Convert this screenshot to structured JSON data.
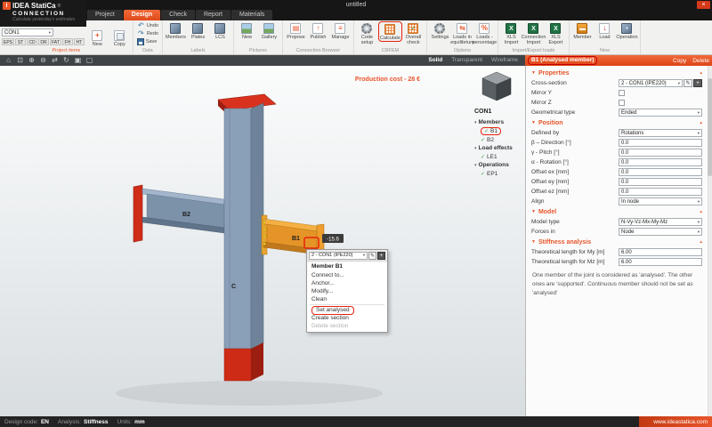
{
  "titlebar": {
    "title": "untitled"
  },
  "brand": {
    "name": "IDEA StatiCa",
    "reg": "®",
    "mark": "i",
    "product": "CONNECTION",
    "tagline": "Calculate yesterday's estimates"
  },
  "tabs": {
    "project": "Project",
    "design": "Design",
    "check": "Check",
    "report": "Report",
    "materials": "Materials"
  },
  "icons": {
    "close": "×",
    "add": "+",
    "edit": "✎",
    "check": "✓",
    "dropdown_arrow": "▾",
    "section_arrow": "▼",
    "collapse_up": "▴",
    "undo": "↶",
    "redo": "↷",
    "home": "⌂",
    "fit": "⊡",
    "zoom_in": "⊕",
    "zoom_out": "⊖",
    "pan": "⇄",
    "orbit": "↻",
    "select": "▣",
    "camera": "▢",
    "propose": "▤",
    "publish": "↑",
    "manage": "≡",
    "equilibrium": "⇆",
    "percent": "%",
    "xls": "X",
    "load_arrow": "↓",
    "member_beam": "▬"
  },
  "ribbon": {
    "project_selector": "CON1",
    "types": {
      "t0": "EPS",
      "t1": "ST",
      "t2": "CD",
      "t3": "DR",
      "t4": "FAT",
      "t5": "FH",
      "t6": "HT"
    },
    "project_items": {
      "name": "Project items",
      "new": "New",
      "copy": "Copy"
    },
    "data": {
      "name": "Data",
      "undo": "Undo",
      "redo": "Redo",
      "save": "Save"
    },
    "labels": {
      "name": "Labels",
      "members": "Members",
      "plates": "Plates",
      "lcs": "LCS"
    },
    "pictures": {
      "name": "Pictures",
      "new": "New",
      "gallery": "Gallery"
    },
    "browser": {
      "name": "Connection Browser",
      "propose": "Propose",
      "publish": "Publish",
      "manage": "Manage"
    },
    "cbfem": {
      "name": "CBFEM",
      "code_setup": "Code setup",
      "calculate": "Calculate",
      "overall_check": "Overall check"
    },
    "options": {
      "name": "Options",
      "settings": "Settings",
      "loads_eq": "Loads in equilibrium",
      "loads_pct": "Loads - percentage"
    },
    "impexp": {
      "name": "Import/Export loads",
      "xls_import": "XLS Import",
      "conn_import": "Connection Import",
      "xls_export": "XLS Export"
    },
    "new_group": {
      "name": "New",
      "member": "Member",
      "load": "Load",
      "operation": "Operation"
    }
  },
  "viewport": {
    "modes": {
      "solid": "Solid",
      "transparent": "Transparent",
      "wireframe": "Wireframe"
    },
    "production_cost": "Production cost - 28 €",
    "dim_label": "-15.6",
    "label_b1": "B1",
    "label_b2": "B2",
    "label_c": "C"
  },
  "tree": {
    "root": "CON1",
    "members": "Members",
    "b1": "B1",
    "b2": "B2",
    "load_effects": "Load effects",
    "le1": "LE1",
    "operations": "Operations",
    "ep1": "EP1"
  },
  "context_menu": {
    "header": "2 - CON1 (IPE220)",
    "title": "Member B1",
    "connect": "Connect to...",
    "anchor": "Anchor...",
    "modify": "Modify...",
    "clean": "Clean",
    "set_analysed": "Set analysed",
    "create_section": "Create section",
    "delete_section": "Delete section"
  },
  "panel": {
    "header": "B1 (Analysed member)",
    "copy": "Copy",
    "delete": "Delete",
    "sec_properties": "Properties",
    "cross_section_label": "Cross-section",
    "cross_section_value": "2 - CON1 (IPE220)",
    "mirror_y": "Mirror Y",
    "mirror_z": "Mirror Z",
    "geom_type_label": "Geometrical type",
    "geom_type_value": "Ended",
    "sec_position": "Position",
    "defined_by_label": "Defined by",
    "defined_by_value": "Rotations",
    "beta_label": "β – Direction [°]",
    "beta_value": "0.0",
    "gamma_label": "γ - Pitch [°]",
    "gamma_value": "0.0",
    "alpha_label": "α - Rotation [°]",
    "alpha_value": "0.0",
    "offset_ex_label": "Offset ex [mm]",
    "offset_ex_value": "0.0",
    "offset_ey_label": "Offset ey [mm]",
    "offset_ey_value": "0.0",
    "offset_ez_label": "Offset ez [mm]",
    "offset_ez_value": "0.0",
    "align_label": "Align",
    "align_value": "In node",
    "sec_model": "Model",
    "model_type_label": "Model type",
    "model_type_value": "N-Vy-Vz-Mx-My-Mz",
    "forces_in_label": "Forces in",
    "forces_in_value": "Node",
    "sec_stiffness": "Stiffness analysis",
    "len_my_label": "Theoretical length for My [m]",
    "len_my_value": "6.00",
    "len_mz_label": "Theoretical length for Mz [m]",
    "len_mz_value": "6.00",
    "note": "One member of the joint is considered as 'analysed'. The other ones are 'supported'. Continuous member should not be set as 'analysed'"
  },
  "statusbar": {
    "design_code_label": "Design code:",
    "design_code": "EN",
    "analysis_label": "Analysis:",
    "analysis": "Stiffness",
    "units_label": "Units:",
    "units": "mm",
    "website": "www.ideastatica.com"
  }
}
